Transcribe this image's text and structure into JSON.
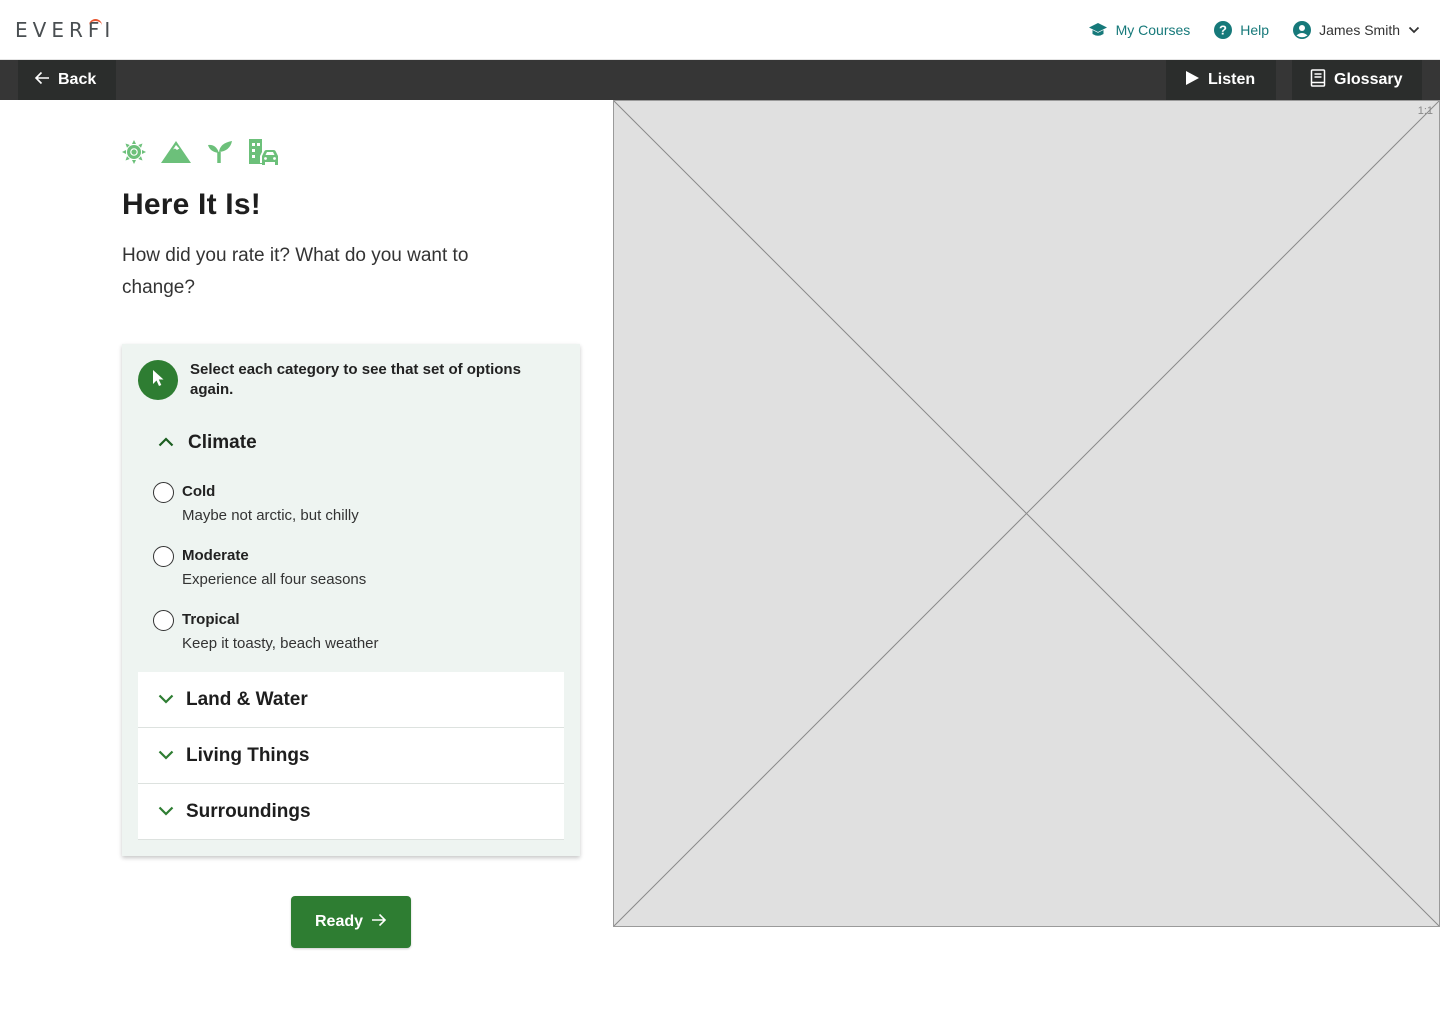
{
  "header": {
    "logo": "EVERFI",
    "nav": {
      "my_courses": "My Courses",
      "help": "Help",
      "user_name": "James Smith"
    }
  },
  "toolbar": {
    "back": "Back",
    "listen": "Listen",
    "glossary": "Glossary"
  },
  "main": {
    "category_icons": [
      "sun-icon",
      "mountain-icon",
      "sprout-icon",
      "city-car-icon"
    ],
    "title": "Here It Is!",
    "subtitle": "How did you rate it? What do you want to change?",
    "hint": "Select each category to see that set of options again.",
    "accordion": {
      "open_section": {
        "title": "Climate",
        "options": [
          {
            "label": "Cold",
            "description": "Maybe not arctic, but chilly",
            "selected": false
          },
          {
            "label": "Moderate",
            "description": "Experience all four seasons",
            "selected": false
          },
          {
            "label": "Tropical",
            "description": "Keep it toasty, beach weather",
            "selected": false
          }
        ]
      },
      "closed_sections": [
        {
          "title": "Land & Water"
        },
        {
          "title": "Living Things"
        },
        {
          "title": "Surroundings"
        }
      ]
    },
    "ready_button": "Ready"
  },
  "image_placeholder": {
    "ratio_label": "1:1"
  },
  "colors": {
    "brand_teal": "#16797a",
    "accent_green": "#2e7d32",
    "icon_green": "#6cc07a",
    "toolbar_bg": "#363636",
    "card_bg": "#eef4f1",
    "logo_accent": "#e8542e"
  }
}
